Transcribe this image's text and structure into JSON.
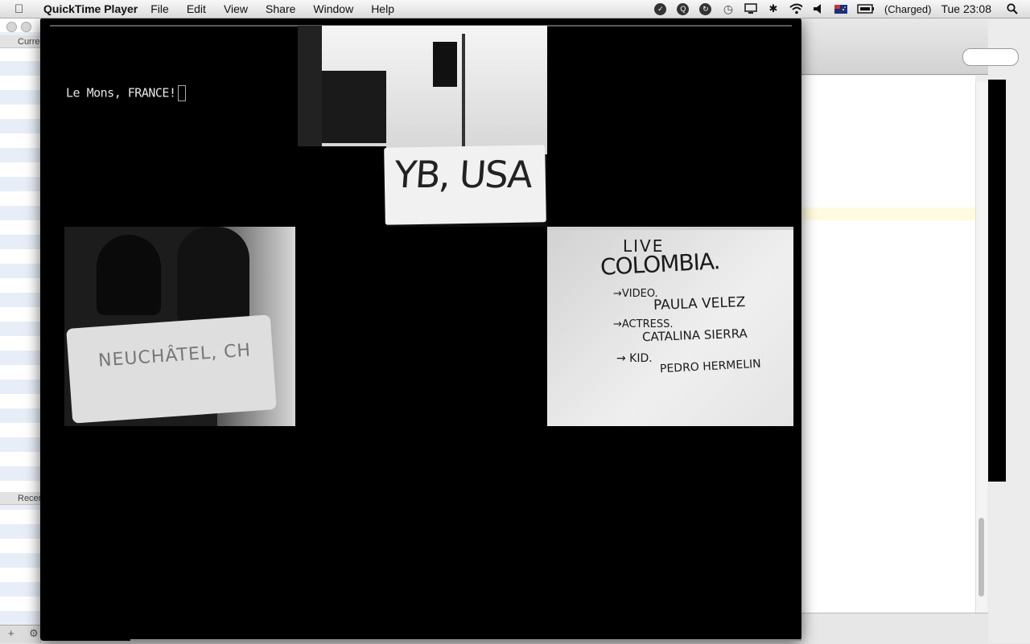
{
  "menubar": {
    "app_name": "QuickTime Player",
    "items": [
      "File",
      "Edit",
      "View",
      "Share",
      "Window",
      "Help"
    ],
    "battery_status": "(Charged)",
    "clock": "Tue 23:08"
  },
  "background_window": {
    "sidebar_header_1": "Curre",
    "sidebar_header_2": "Recen"
  },
  "video": {
    "overlay_caption": "Le Mons, FRANCE!",
    "sign_usa": "YB, USA",
    "sign_ch": "NEUCHÂTEL, CH",
    "colombia_sign": {
      "line1": "LIVE",
      "line2": "COLOMBIA.",
      "line3": "→VIDEO.",
      "line4": "PAULA VELEZ",
      "line5": "→ACTRESS.",
      "line6": "CATALINA SIERRA",
      "line7": "→ KID.",
      "line8": "PEDRO HERMELIN"
    }
  }
}
